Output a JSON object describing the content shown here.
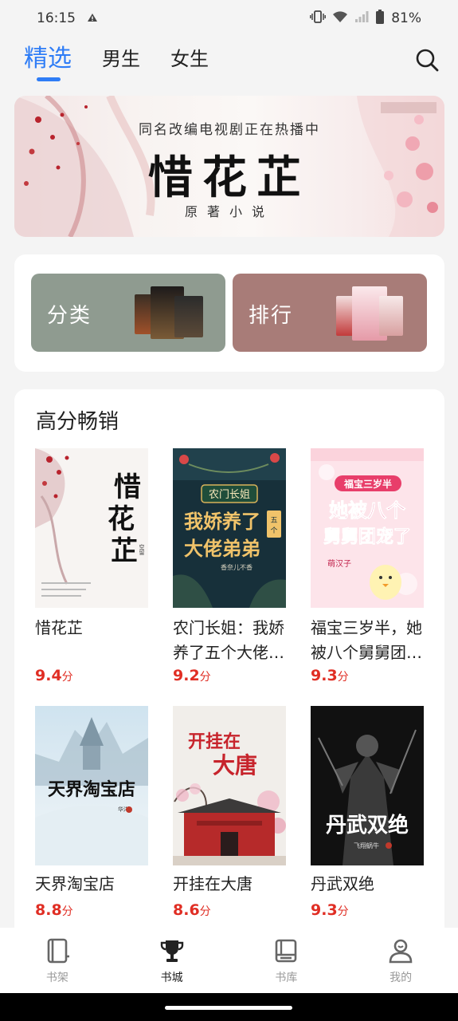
{
  "status_bar": {
    "time": "16:15",
    "battery": "81%"
  },
  "tabs": [
    {
      "label": "精选",
      "active": true
    },
    {
      "label": "男生",
      "active": false
    },
    {
      "label": "女生",
      "active": false
    }
  ],
  "banner": {
    "subtitle": "同名改编电视剧正在热播中",
    "title": "惜花芷",
    "footer": "原著小说"
  },
  "quick_entries": [
    {
      "label": "分类"
    },
    {
      "label": "排行"
    }
  ],
  "section": {
    "title": "高分畅销",
    "books": [
      {
        "title": "惜花芷",
        "score": "9.4",
        "unit": "分"
      },
      {
        "title": "农门长姐：我娇养了五个大佬弟弟",
        "score": "9.2",
        "unit": "分"
      },
      {
        "title": "福宝三岁半，她被八个舅舅团宠了",
        "score": "9.3",
        "unit": "分"
      },
      {
        "title": "天界淘宝店",
        "score": "8.8",
        "unit": "分"
      },
      {
        "title": "开挂在大唐",
        "score": "8.6",
        "unit": "分"
      },
      {
        "title": "丹武双绝",
        "score": "9.3",
        "unit": "分"
      }
    ]
  },
  "covers": {
    "book0": {
      "vertical_title": "惜花芷",
      "author": "空留"
    },
    "book1": {
      "badge": "农门长姐",
      "line1": "我娇养了",
      "line2": "大佬弟弟",
      "side": "五个",
      "author": "香奈儿不香"
    },
    "book2": {
      "badge": "福宝三岁半",
      "line1": "她被八个",
      "line2": "舅舅团宠了",
      "author": "萌汉子"
    },
    "book3": {
      "title": "天界淘宝店",
      "author": "华洋"
    },
    "book4": {
      "title_a": "开挂在",
      "title_b": "大唐"
    },
    "book5": {
      "title": "丹武双绝",
      "author": "飞翔蜗牛"
    }
  },
  "bottom_nav": [
    {
      "label": "书架",
      "icon": "bookshelf-icon",
      "active": false
    },
    {
      "label": "书城",
      "icon": "trophy-icon",
      "active": true
    },
    {
      "label": "书库",
      "icon": "library-icon",
      "active": false
    },
    {
      "label": "我的",
      "icon": "profile-icon",
      "active": false
    }
  ],
  "colors": {
    "accent": "#2f7df6",
    "score": "#e02e24",
    "category_bg": "#8f9b90",
    "rank_bg": "#a87c78"
  }
}
